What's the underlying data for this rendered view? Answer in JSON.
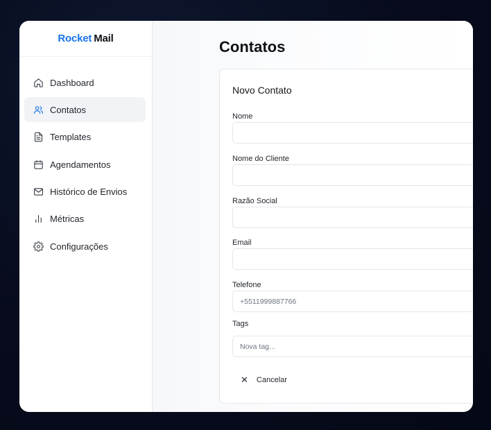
{
  "brand": {
    "part1": "Rocket",
    "part2": "Mail",
    "accent_color": "#1a73e8"
  },
  "sidebar": {
    "items": [
      {
        "label": "Dashboard",
        "icon": "home-icon",
        "active": false
      },
      {
        "label": "Contatos",
        "icon": "users-icon",
        "active": true
      },
      {
        "label": "Templates",
        "icon": "file-text-icon",
        "active": false
      },
      {
        "label": "Agendamentos",
        "icon": "calendar-icon",
        "active": false
      },
      {
        "label": "Histórico de Envios",
        "icon": "mail-icon",
        "active": false
      },
      {
        "label": "Métricas",
        "icon": "bar-chart-icon",
        "active": false
      },
      {
        "label": "Configurações",
        "icon": "gear-icon",
        "active": false
      }
    ]
  },
  "main": {
    "title": "Contatos",
    "form": {
      "title": "Novo Contato",
      "fields": [
        {
          "label": "Nome",
          "value": "",
          "placeholder": ""
        },
        {
          "label": "Nome do Cliente",
          "value": "",
          "placeholder": ""
        },
        {
          "label": "Razão Social",
          "value": "",
          "placeholder": ""
        },
        {
          "label": "Email",
          "value": "",
          "placeholder": ""
        },
        {
          "label": "Telefone",
          "value": "",
          "placeholder": "+5511999887766"
        },
        {
          "label": "Tags",
          "value": "",
          "placeholder": "Nova tag..."
        }
      ],
      "cancel_label": "Cancelar",
      "cancel_icon": "close-icon"
    }
  }
}
